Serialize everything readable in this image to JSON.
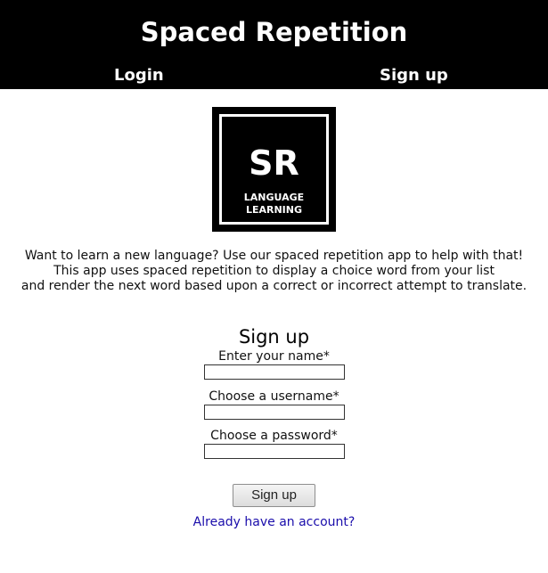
{
  "header": {
    "title": "Spaced Repetition",
    "nav": {
      "login_label": "Login",
      "signup_label": "Sign up"
    }
  },
  "logo": {
    "mark": "SR",
    "line1": "LANGUAGE",
    "line2": "LEARNING"
  },
  "intro": {
    "line1": "Want to learn a new language? Use our spaced repetition app to help with that!",
    "line2": "This app uses spaced repetition to display a choice word from your list",
    "line3": "and render the next word based upon a correct or incorrect attempt to translate."
  },
  "signup_form": {
    "title": "Sign up",
    "name_label": "Enter your name*",
    "name_value": "",
    "username_label": "Choose a username*",
    "username_value": "",
    "password_label": "Choose a password*",
    "password_value": "",
    "submit_label": "Sign up",
    "login_link": "Already have an account?"
  },
  "colors": {
    "header_background": "#000000",
    "header_text": "#ffffff",
    "link": "#1a0dab"
  }
}
